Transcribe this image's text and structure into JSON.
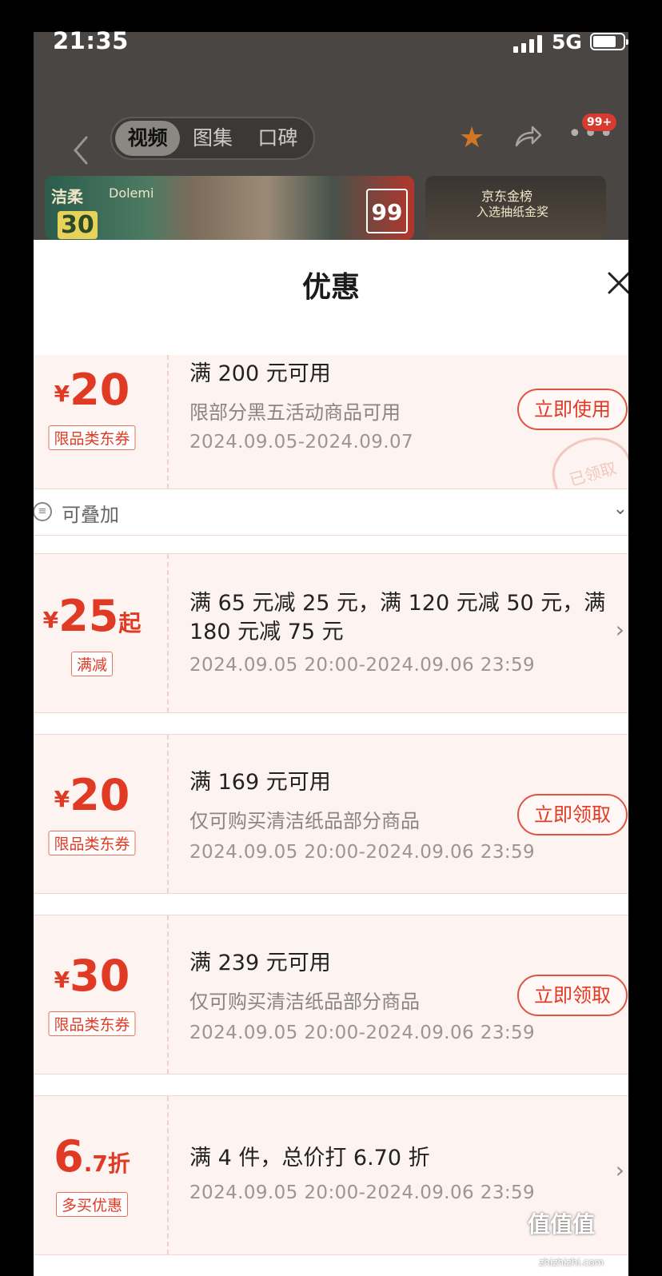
{
  "status_bar": {
    "time": "21:35",
    "network": "5G"
  },
  "header": {
    "tabs": [
      {
        "label": "视频",
        "active": true
      },
      {
        "label": "图集"
      },
      {
        "label": "口碑"
      }
    ],
    "badge": "99+"
  },
  "thumbnails": {
    "brand1": "洁柔",
    "brand2": "Dolemi",
    "coupon_value": "30",
    "promo_number": "99",
    "award_text": "京东金榜",
    "award_sub": "入选抽纸金奖"
  },
  "sheet": {
    "title": "优惠"
  },
  "coupons": [
    {
      "yen": "¥",
      "amount": "20",
      "tag": "限品类东券",
      "line1": "满 200 元可用",
      "line2": "限部分黑五活动商品可用",
      "line3": "2024.09.05-2024.09.07",
      "button": "立即使用",
      "stamp": "已领取",
      "stack_label": "可叠加"
    },
    {
      "yen": "¥",
      "amount": "25",
      "suffix": "起",
      "tag": "满减",
      "line1": "满 65 元减 25 元，满 120 元减 50 元，满",
      "line1b": "180 元减 75 元",
      "line3": "2024.09.05 20:00-2024.09.06 23:59"
    },
    {
      "yen": "¥",
      "amount": "20",
      "tag": "限品类东券",
      "line1": "满 169 元可用",
      "line2": "仅可购买清洁纸品部分商品",
      "line3": "2024.09.05 20:00-2024.09.06 23:59",
      "button": "立即领取"
    },
    {
      "yen": "¥",
      "amount": "30",
      "tag": "限品类东券",
      "line1": "满 239 元可用",
      "line2": "仅可购买清洁纸品部分商品",
      "line3": "2024.09.05 20:00-2024.09.06 23:59",
      "button": "立即领取"
    },
    {
      "amount": "6",
      "decimal": ".7",
      "suffix": "折",
      "tag": "多买优惠",
      "line1": "满 4 件，总价打 6.70 折",
      "line3": "2024.09.05 20:00-2024.09.06 23:59"
    }
  ],
  "watermark": {
    "text": "值值值",
    "url": "zhizhizhi.com"
  },
  "colors": {
    "accent": "#e03a24",
    "coupon_bg": "#fdf3f1",
    "star": "#d07624"
  }
}
